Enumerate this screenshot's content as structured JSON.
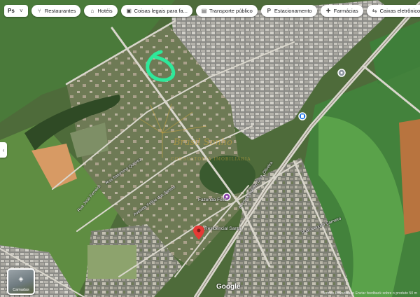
{
  "chips": [
    {
      "icon": "fork-knife-icon",
      "glyph": "⑂",
      "label": "Restaurantes"
    },
    {
      "icon": "bed-icon",
      "glyph": "⌂",
      "label": "Hotéis"
    },
    {
      "icon": "camera-icon",
      "glyph": "▣",
      "label": "Coisas legais para fa..."
    },
    {
      "icon": "bus-icon",
      "glyph": "▤",
      "label": "Transporte público"
    },
    {
      "icon": "parking-icon",
      "glyph": "P",
      "label": "Estacionamento"
    },
    {
      "icon": "pharmacy-icon",
      "glyph": "✚",
      "label": "Farmácias"
    },
    {
      "icon": "atm-icon",
      "glyph": "⇆",
      "label": "Caixas eletrônicos"
    }
  ],
  "menu_chip": {
    "label": "Ps",
    "icon": "chevron-down-icon",
    "glyph": "˅"
  },
  "side_toggle_glyph": "‹",
  "layers": {
    "label": "Camadas",
    "icon": "layers-icon",
    "glyph": "◈"
  },
  "logo": "Google",
  "credits": "Termos  Privacidade  Enviar feedback sobre o produto  50 m",
  "watermark": {
    "line1": "Brasil Sonho",
    "line2": "CONSULTORIA IMOBILIÁRIA"
  },
  "road_labels": [
    "Avenida Vicente Sant. Oliveira",
    "Rua Saturnino Queiroz",
    "Avenida Felipe dos Santos",
    "Rua José Ferreira",
    "Rua Joaquim Carneiro"
  ],
  "poi_labels": [
    "Fazenda Feliz",
    "Residencial Santa"
  ],
  "colors": {
    "highlight": "#2ee89a",
    "pin": "#e53935",
    "poi_purple": "#8e44ad",
    "transit_blue": "#1a73e8"
  }
}
